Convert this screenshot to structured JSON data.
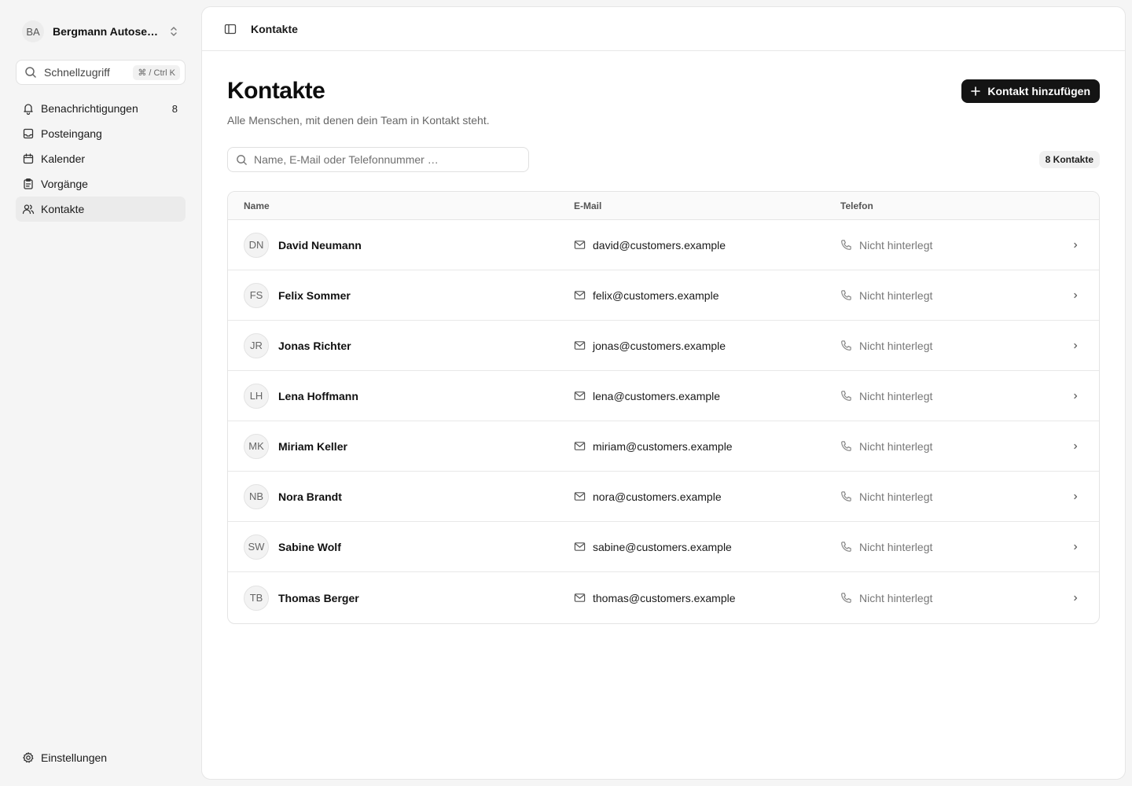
{
  "sidebar": {
    "org": {
      "initials": "BA",
      "name": "Bergmann Autose…"
    },
    "quick_access": {
      "label": "Schnellzugriff",
      "shortcut": "⌘ / Ctrl K"
    },
    "nav": [
      {
        "label": "Benachrichtigungen",
        "icon": "bell-icon",
        "count": "8"
      },
      {
        "label": "Posteingang",
        "icon": "inbox-icon"
      },
      {
        "label": "Kalender",
        "icon": "calendar-icon"
      },
      {
        "label": "Vorgänge",
        "icon": "clipboard-icon"
      },
      {
        "label": "Kontakte",
        "icon": "users-icon",
        "active": true
      }
    ],
    "settings_label": "Einstellungen"
  },
  "topbar": {
    "breadcrumb": "Kontakte"
  },
  "page": {
    "title": "Kontakte",
    "subtitle": "Alle Menschen, mit denen dein Team in Kontakt steht.",
    "add_button": "Kontakt hinzufügen",
    "search_placeholder": "Name, E-Mail oder Telefonnummer …",
    "count_badge": "8 Kontakte"
  },
  "table": {
    "headers": {
      "name": "Name",
      "email": "E-Mail",
      "phone": "Telefon"
    },
    "rows": [
      {
        "initials": "DN",
        "name": "David Neumann",
        "email": "david@customers.example",
        "phone": "Nicht hinterlegt"
      },
      {
        "initials": "FS",
        "name": "Felix Sommer",
        "email": "felix@customers.example",
        "phone": "Nicht hinterlegt"
      },
      {
        "initials": "JR",
        "name": "Jonas Richter",
        "email": "jonas@customers.example",
        "phone": "Nicht hinterlegt"
      },
      {
        "initials": "LH",
        "name": "Lena Hoffmann",
        "email": "lena@customers.example",
        "phone": "Nicht hinterlegt"
      },
      {
        "initials": "MK",
        "name": "Miriam Keller",
        "email": "miriam@customers.example",
        "phone": "Nicht hinterlegt"
      },
      {
        "initials": "NB",
        "name": "Nora Brandt",
        "email": "nora@customers.example",
        "phone": "Nicht hinterlegt"
      },
      {
        "initials": "SW",
        "name": "Sabine Wolf",
        "email": "sabine@customers.example",
        "phone": "Nicht hinterlegt"
      },
      {
        "initials": "TB",
        "name": "Thomas Berger",
        "email": "thomas@customers.example",
        "phone": "Nicht hinterlegt"
      }
    ]
  },
  "colors": {
    "button_bg": "#141414",
    "active_nav_bg": "#ebebeb",
    "page_bg": "#f5f5f5"
  }
}
